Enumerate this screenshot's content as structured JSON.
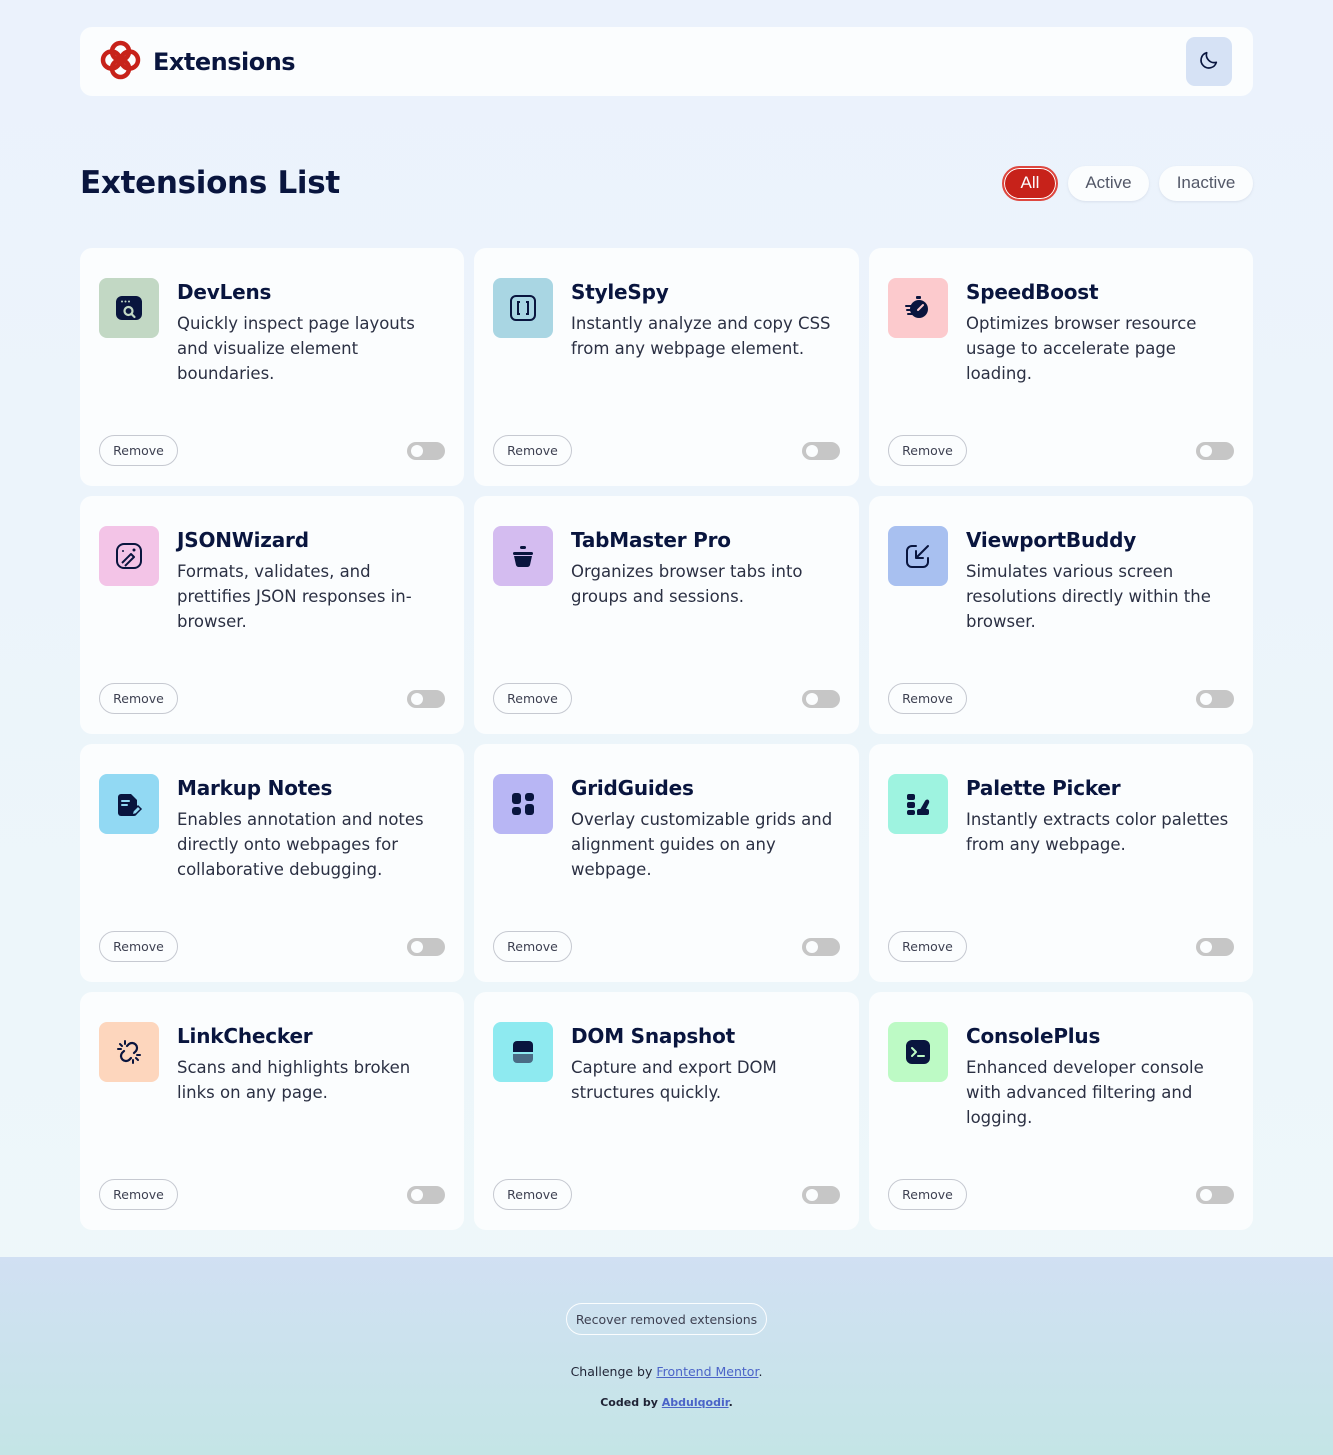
{
  "header": {
    "title": "Extensions"
  },
  "list": {
    "title": "Extensions List"
  },
  "filters": {
    "all": "All",
    "active": "Active",
    "inactive": "Inactive"
  },
  "colors": {
    "accent": "#c7221a",
    "text": "#09153e",
    "toggle_off": "#c6c6c6"
  },
  "extensions": [
    {
      "name": "DevLens",
      "description": "Quickly inspect page layouts and visualize element boundaries.",
      "remove": "Remove",
      "icon": "devlens-icon",
      "icon_bg": "#c2d8c4",
      "active": false
    },
    {
      "name": "StyleSpy",
      "description": "Instantly analyze and copy CSS from any webpage element.",
      "remove": "Remove",
      "icon": "stylespy-icon",
      "icon_bg": "#a9d6e3",
      "active": false
    },
    {
      "name": "SpeedBoost",
      "description": "Optimizes browser resource usage to accelerate page loading.",
      "remove": "Remove",
      "icon": "speedboost-icon",
      "icon_bg": "#fccacd",
      "active": false
    },
    {
      "name": "JSONWizard",
      "description": "Formats, validates, and prettifies JSON responses in-browser.",
      "remove": "Remove",
      "icon": "jsonwizard-icon",
      "icon_bg": "#f3c4e7",
      "active": false
    },
    {
      "name": "TabMaster Pro",
      "description": "Organizes browser tabs into groups and sessions.",
      "remove": "Remove",
      "icon": "tabmaster-icon",
      "icon_bg": "#d4bcf0",
      "active": false
    },
    {
      "name": "ViewportBuddy",
      "description": "Simulates various screen resolutions directly within the browser.",
      "remove": "Remove",
      "icon": "viewportbuddy-icon",
      "icon_bg": "#a8c0f0",
      "active": false
    },
    {
      "name": "Markup Notes",
      "description": "Enables annotation and notes directly onto webpages for collaborative debugging.",
      "remove": "Remove",
      "icon": "markupnotes-icon",
      "icon_bg": "#92d9f3",
      "active": false
    },
    {
      "name": "GridGuides",
      "description": "Overlay customizable grids and alignment guides on any webpage.",
      "remove": "Remove",
      "icon": "gridguides-icon",
      "icon_bg": "#b8b6f4",
      "active": false
    },
    {
      "name": "Palette Picker",
      "description": "Instantly extracts color palettes from any webpage.",
      "remove": "Remove",
      "icon": "palettepicker-icon",
      "icon_bg": "#9ef3e0",
      "active": false
    },
    {
      "name": "LinkChecker",
      "description": "Scans and highlights broken links on any page.",
      "remove": "Remove",
      "icon": "linkchecker-icon",
      "icon_bg": "#fdd6bd",
      "active": false
    },
    {
      "name": "DOM Snapshot",
      "description": "Capture and export DOM structures quickly.",
      "remove": "Remove",
      "icon": "domsnapshot-icon",
      "icon_bg": "#8eeaf0",
      "active": false
    },
    {
      "name": "ConsolePlus",
      "description": "Enhanced developer console with advanced filtering and logging.",
      "remove": "Remove",
      "icon": "consoleplus-icon",
      "icon_bg": "#bdfac5",
      "active": false
    }
  ],
  "footer": {
    "recover": "Recover removed extensions",
    "challenge_prefix": "Challenge by ",
    "challenge_link": "Frontend Mentor",
    "challenge_suffix": ".",
    "coded_prefix": "Coded by ",
    "coded_link": "Abdulqodir",
    "coded_suffix": "."
  }
}
